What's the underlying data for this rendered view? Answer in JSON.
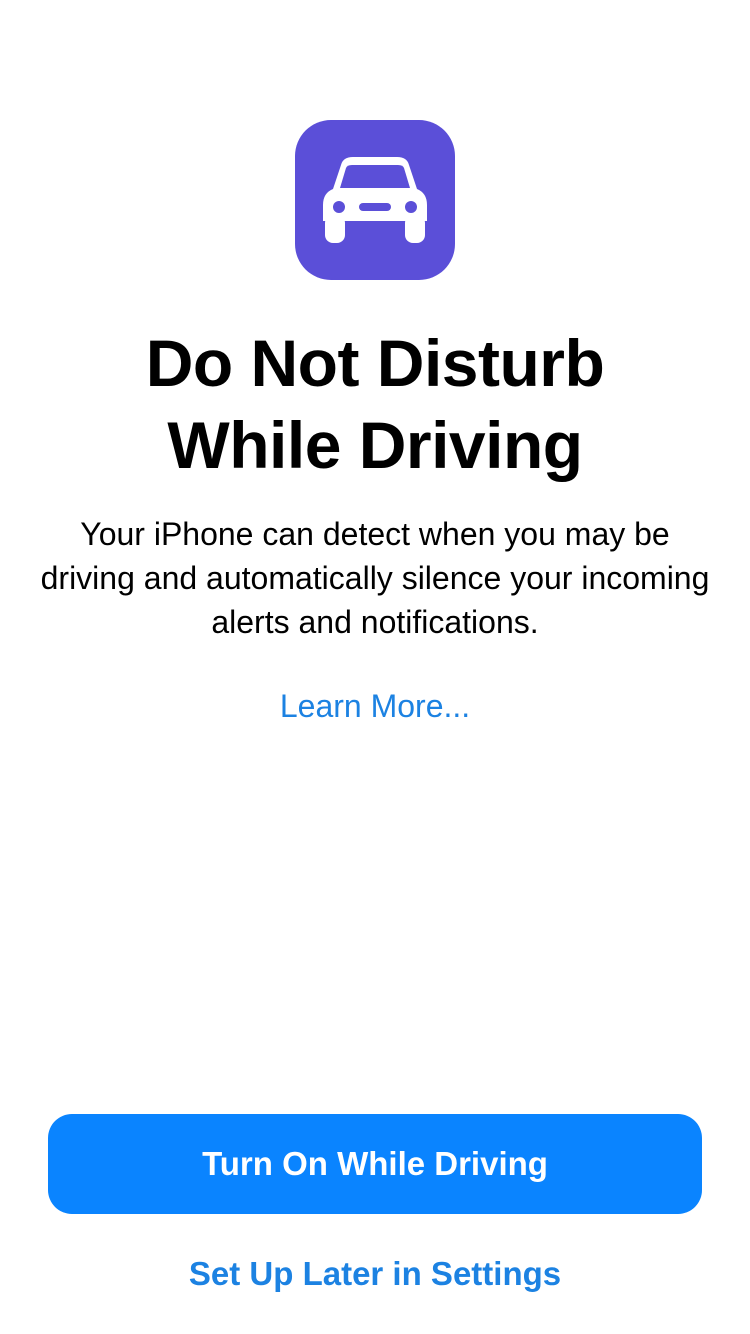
{
  "colors": {
    "accent": "#0A84FF",
    "link": "#1C82E2",
    "icon_background": "#5B4FD8",
    "background": "#FFFFFF",
    "text": "#000000"
  },
  "icon": {
    "name": "car-icon"
  },
  "title": {
    "line1": "Do Not Disturb",
    "line2": "While Driving"
  },
  "description": "Your iPhone can detect when you may be driving and automatically silence your incoming alerts and notifications.",
  "learn_more_label": "Learn More...",
  "primary_button_label": "Turn On While Driving",
  "secondary_button_label": "Set Up Later in Settings"
}
